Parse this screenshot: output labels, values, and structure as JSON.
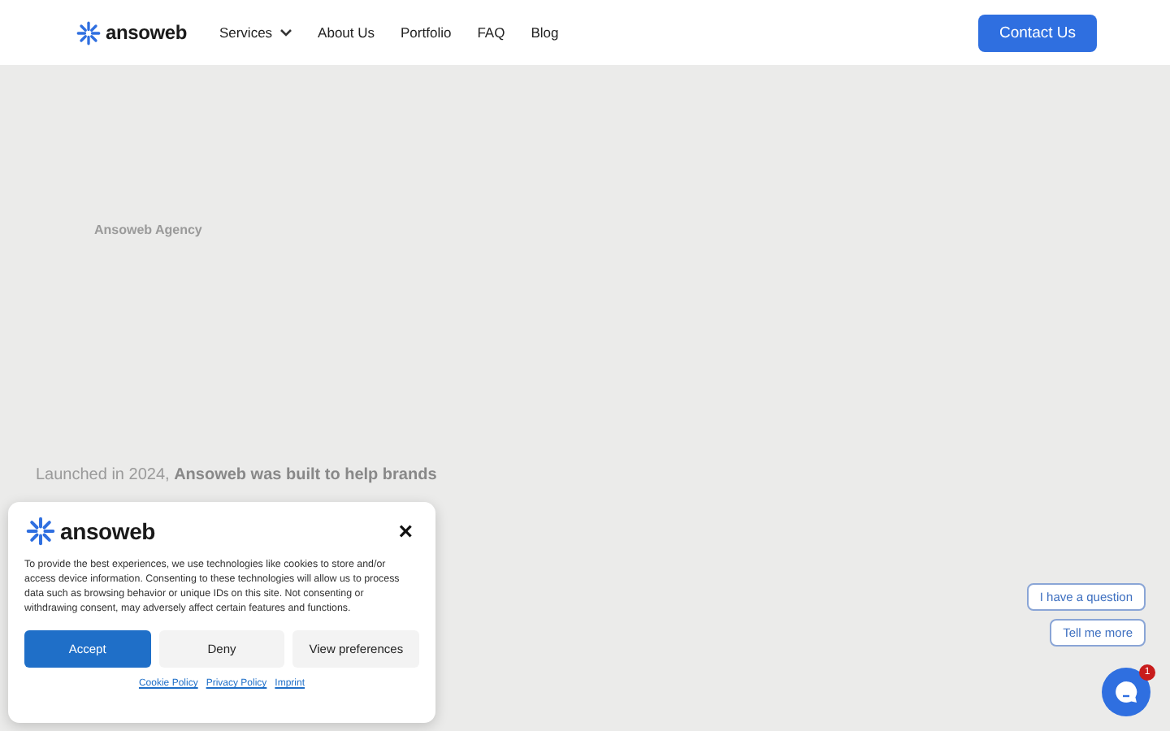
{
  "header": {
    "logo": "ansoweb",
    "nav": [
      {
        "label": "Services",
        "dropdown": true
      },
      {
        "label": "About Us",
        "dropdown": false
      },
      {
        "label": "Portfolio",
        "dropdown": false
      },
      {
        "label": "FAQ",
        "dropdown": false
      },
      {
        "label": "Blog",
        "dropdown": false
      }
    ],
    "cta": "Contact Us"
  },
  "hero": {
    "eyebrow": "Ansoweb Agency",
    "intro": "Launched in 2024, **Ansoweb was built to help brands**"
  },
  "cookie_dialog": {
    "logo": "ansoweb",
    "close": "×",
    "text": "To provide the best experiences, we use technologies like cookies to store and/or access device information. Consenting to these technologies will allow us to process data such as browsing behavior or unique IDs on this site. Not consenting or withdrawing consent, may adversely affect certain features and functions.",
    "buttons": [
      {
        "label": "Accept",
        "kind": "primary"
      },
      {
        "label": "Deny",
        "kind": "secondary"
      },
      {
        "label": "View preferences",
        "kind": "secondary"
      }
    ],
    "links": [
      "Cookie Policy",
      "Privacy Policy",
      "Imprint"
    ]
  },
  "chat": {
    "suggestions": [
      "I have a question",
      "Tell me more"
    ],
    "badge": "1"
  }
}
